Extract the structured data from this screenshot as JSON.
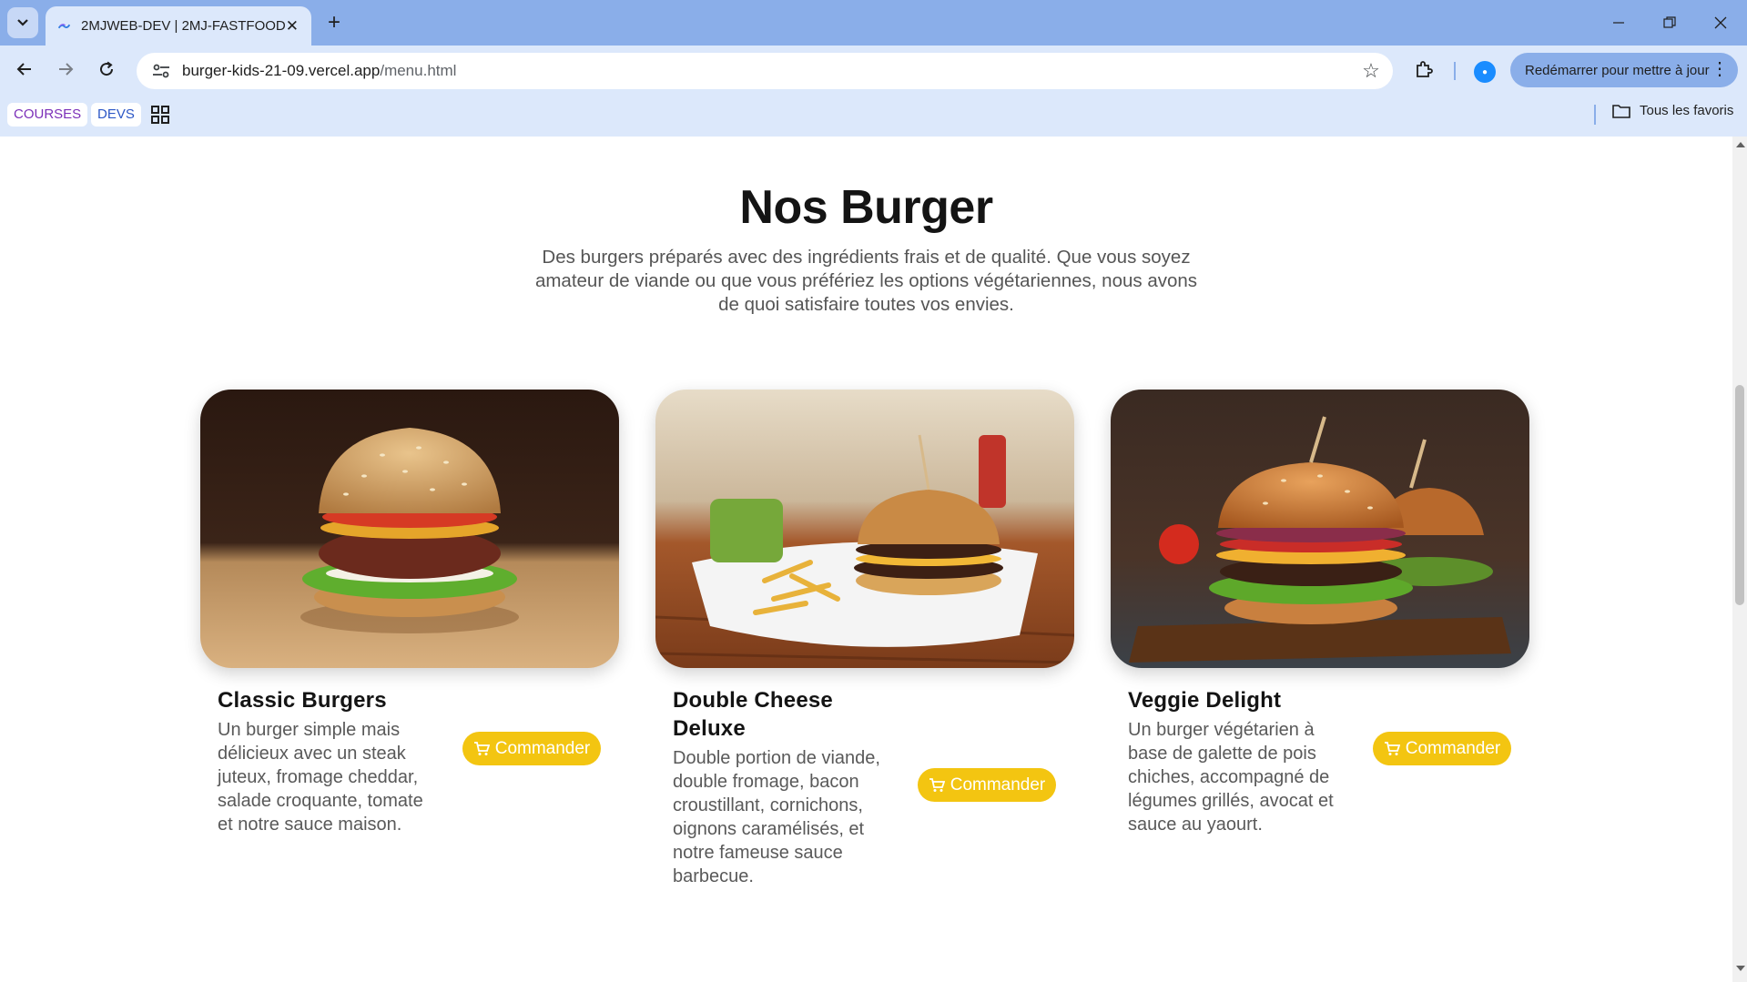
{
  "browser": {
    "tab_title": "2MJWEB-DEV | 2MJ-FASTFOOD",
    "url_host": "burger-kids-21-09.vercel.app",
    "url_path": "/menu.html",
    "update_button": "Redémarrer pour mettre à jour",
    "bookmarks": [
      {
        "label": "COURSES"
      },
      {
        "label": "DEVS"
      }
    ],
    "all_bookmarks": "Tous les favoris"
  },
  "page": {
    "heading": "Nos Burger",
    "intro": "Des burgers préparés avec des ingrédients frais et de qualité. Que vous soyez amateur de viande ou que vous préfériez les options végétariennes, nous avons de quoi satisfaire toutes vos envies.",
    "cards": [
      {
        "title": "Classic Burgers",
        "description": "Un burger simple mais délicieux avec un steak juteux, fromage cheddar, salade croquante, tomate et notre sauce maison.",
        "button": "Commander"
      },
      {
        "title": "Double Cheese Deluxe",
        "description": "Double portion de viande, double fromage, bacon croustillant, cornichons, oignons caramélisés, et notre fameuse sauce barbecue.",
        "button": "Commander"
      },
      {
        "title": "Veggie Delight",
        "description": "Un burger végétarien à base de galette de pois chiches, accompagné de légumes grillés, avocat et sauce au yaourt.",
        "button": "Commander"
      }
    ]
  },
  "colors": {
    "tabstrip": "#8aaee9",
    "toolbar": "#dce8fb",
    "button_accent": "#f3c511",
    "heading": "#141414",
    "body_text": "#595959"
  },
  "icons": [
    "tab-search-icon",
    "globe-favicon",
    "close-icon",
    "plus-icon",
    "minimize-icon",
    "restore-icon",
    "window-close-icon",
    "back-arrow-icon",
    "forward-arrow-icon",
    "reload-icon",
    "site-info-icon",
    "star-icon",
    "extensions-icon",
    "profile-icon",
    "more-vert-icon",
    "apps-grid-icon",
    "folder-icon",
    "cart-icon"
  ]
}
